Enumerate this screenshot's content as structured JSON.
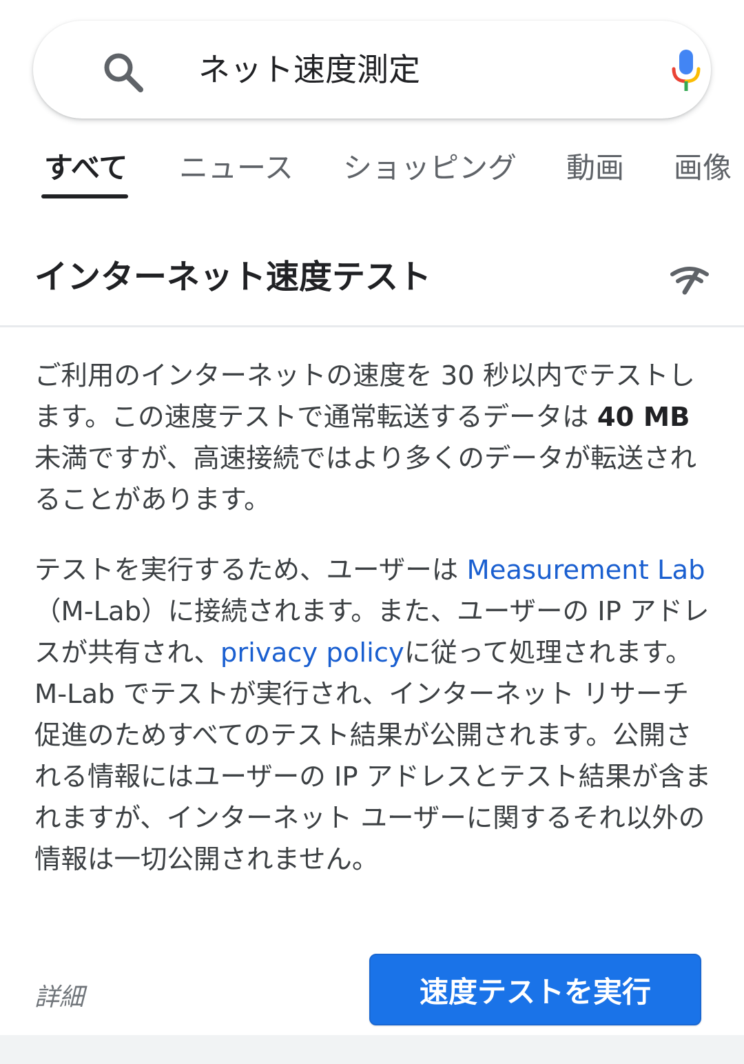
{
  "search": {
    "query": "ネット速度測定"
  },
  "tabs": [
    {
      "label": "すべて",
      "active": true
    },
    {
      "label": "ニュース",
      "active": false
    },
    {
      "label": "ショッピング",
      "active": false
    },
    {
      "label": "動画",
      "active": false
    },
    {
      "label": "画像",
      "active": false
    }
  ],
  "card": {
    "title": "インターネット速度テスト",
    "icon": "speed-test-icon",
    "para1": {
      "part1": "ご利用のインターネットの速度を 30 秒以内でテストします。この速度テストで通常転送するデータは ",
      "bold": "40 MB",
      "part2": " 未満ですが、高速接続ではより多くのデータが転送されることがあります。"
    },
    "para2": {
      "part1": "テストを実行するため、ユーザーは ",
      "link1": "Measurement Lab",
      "part2": "（M-Lab）に接続されます。また、ユーザーの IP アドレスが共有され、",
      "link2": "privacy policy",
      "part3": "に従って処理されます。M-Lab でテストが実行され、インターネット リサーチ促進のためすべてのテスト結果が公開されます。公開される情報にはユーザーの IP アドレスとテスト結果が含まれますが、インターネット ユーザーに関するそれ以外の情報は一切公開されません。"
    },
    "details_label": "詳細",
    "run_button_label": "速度テストを実行"
  },
  "colors": {
    "link": "#1a5fd0",
    "button": "#1a73e8",
    "mic_blue": "#4285f4",
    "mic_red": "#ea4335",
    "mic_yellow": "#fbbc04",
    "mic_green": "#34a853"
  }
}
